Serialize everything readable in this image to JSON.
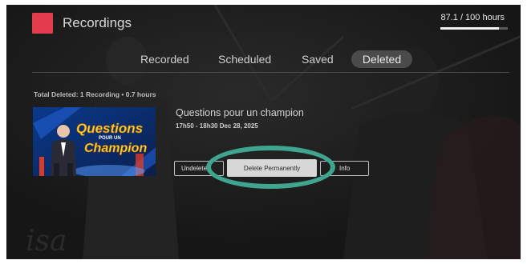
{
  "app": {
    "title": "Recordings",
    "logo_color": "#e23c4d"
  },
  "storage": {
    "label": "87.1 / 100 hours",
    "used_fraction": 0.871
  },
  "tabs": [
    {
      "label": "Recorded",
      "selected": false
    },
    {
      "label": "Scheduled",
      "selected": false
    },
    {
      "label": "Saved",
      "selected": false
    },
    {
      "label": "Deleted",
      "selected": true
    }
  ],
  "summary": "Total Deleted: 1 Recording • 0.7 hours",
  "recording": {
    "title": "Questions pour un champion",
    "time": "17h50 - 18h30 Dec 28, 2025",
    "thumbnail_icon": "show-thumbnail-image"
  },
  "actions": {
    "undelete_label": "Undelete",
    "delete_label": "Delete Permanently",
    "info_label": "Info",
    "highlight_color": "#3fa58f"
  }
}
